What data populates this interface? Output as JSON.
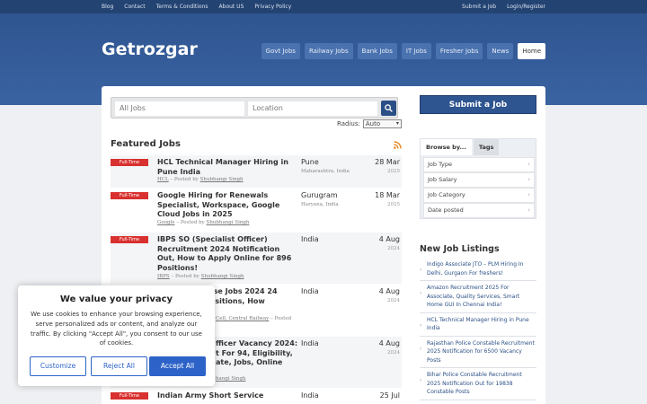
{
  "topbar": {
    "left_links": [
      "Blog",
      "Contact",
      "Terms & Conditions",
      "About US",
      "Privacy Policy"
    ],
    "right_links": [
      "Submit a Job",
      "Login/Register"
    ]
  },
  "header": {
    "logo": "Getrozgar",
    "nav": [
      "Govt Jobs",
      "Railway Jobs",
      "Bank Jobs",
      "IT Jobs",
      "Fresher Jobs",
      "News",
      "Home"
    ],
    "active_nav": "Home"
  },
  "search": {
    "keywords_placeholder": "All Jobs",
    "location_placeholder": "Location",
    "radius_label": "Radius:",
    "radius_value": "Auto"
  },
  "featured": {
    "title": "Featured Jobs",
    "jobs": [
      {
        "type": "Full-Time",
        "title": "HCL Technical Manager Hiring in Pune India",
        "company": "HCL",
        "posted_by": "Posted by",
        "poster": "Shubhangi Singh",
        "location": "Pune",
        "region": "Maharashtra, India",
        "date": "28 Mar",
        "year": "2025"
      },
      {
        "type": "Full-Time",
        "title": "Google Hiring for Renewals Specialist, Workspace, Google Cloud Jobs in 2025",
        "company": "Google",
        "posted_by": "Posted by",
        "poster": "Shubhangi Singh",
        "location": "Gurugram",
        "region": "Haryana, India",
        "date": "18 Mar",
        "year": "2025"
      },
      {
        "type": "Full-Time",
        "title": "IBPS SO (Specialist Officer) Recruitment 2024 Notification Out, How to Apply Online for 896 Positions!",
        "company": "IBPS",
        "posted_by": "Posted by",
        "poster": "Shubhangi Singh",
        "location": "India",
        "region": "",
        "date": "4 Aug",
        "year": "2024"
      },
      {
        "type": "Full-Time",
        "title": "urse Jobs 2024 24 Positions, How",
        "company": "Cell, Central Railway",
        "posted_by": "Posted",
        "poster": "",
        "location": "India",
        "region": "",
        "date": "4 Aug",
        "year": "2024"
      },
      {
        "type": "Full-Time",
        "title": "fficer Vacancy 2024: t For 94, Eligibility, ate, Jobs, Online",
        "company": "",
        "posted_by": "",
        "poster": "hangi Singh",
        "location": "India",
        "region": "",
        "date": "4 Aug",
        "year": "2024"
      },
      {
        "type": "Full-Time",
        "title": "Indian Army Short Service",
        "company": "",
        "posted_by": "",
        "poster": "",
        "location": "India",
        "region": "",
        "date": "25 Jul",
        "year": ""
      }
    ]
  },
  "sidebar": {
    "submit_label": "Submit a Job",
    "tabs": [
      "Browse by...",
      "Tags"
    ],
    "browse_items": [
      "Job Type",
      "Job Salary",
      "Job Category",
      "Date posted"
    ],
    "new_jobs_title": "New Job Listings",
    "new_jobs": [
      "Indigo Associate JTO – PLM Hiring In Delhi, Gurgaon For freshers!",
      "Amazon Recruitment 2025 For Associate, Quality Services, Smart Home GUI In Chennai India!",
      "HCL Technical Manager Hiring in Pune India",
      "Rajasthan Police Constable Recruitment 2025 Notification for 6500 Vacancy Posts",
      "Bihar Police Constable Recruitment 2025 Notification Out for 19838 Constable Posts"
    ]
  },
  "cookie": {
    "title": "We value your privacy",
    "text": "We use cookies to enhance your browsing experience, serve personalized ads or content, and analyze our traffic. By clicking \"Accept All\", you consent to our use of cookies.",
    "customize": "Customize",
    "reject": "Reject All",
    "accept": "Accept All"
  }
}
